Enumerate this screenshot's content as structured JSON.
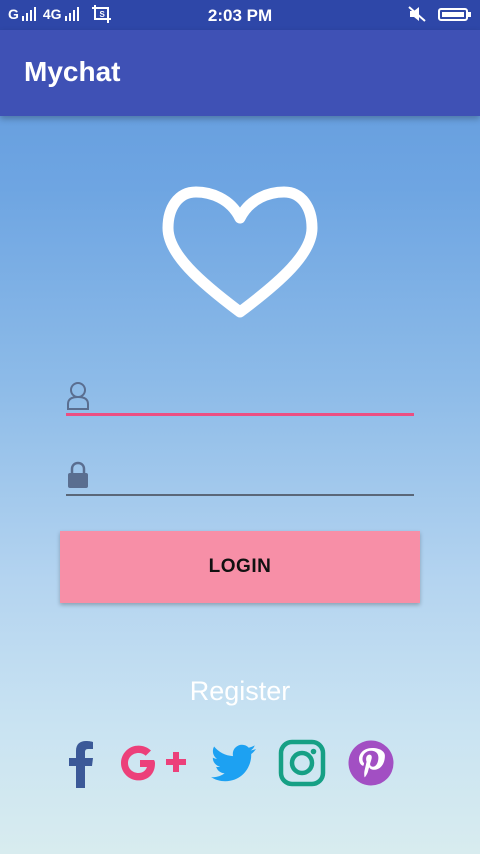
{
  "status_bar": {
    "carrier_left": "G",
    "network": "4G",
    "time": "2:03 PM"
  },
  "app_bar": {
    "title": "Mychat"
  },
  "login_form": {
    "username_placeholder": "",
    "password_placeholder": "",
    "login_label": "LOGIN"
  },
  "register_label": "Register",
  "colors": {
    "status_bar": "#2e47a8",
    "app_bar": "#3f51b5",
    "accent_pink": "#ec4f82",
    "login_button": "#f78fa7"
  },
  "social": [
    {
      "name": "facebook-icon"
    },
    {
      "name": "google-plus-icon"
    },
    {
      "name": "twitter-icon"
    },
    {
      "name": "instagram-icon"
    },
    {
      "name": "pinterest-icon"
    }
  ]
}
